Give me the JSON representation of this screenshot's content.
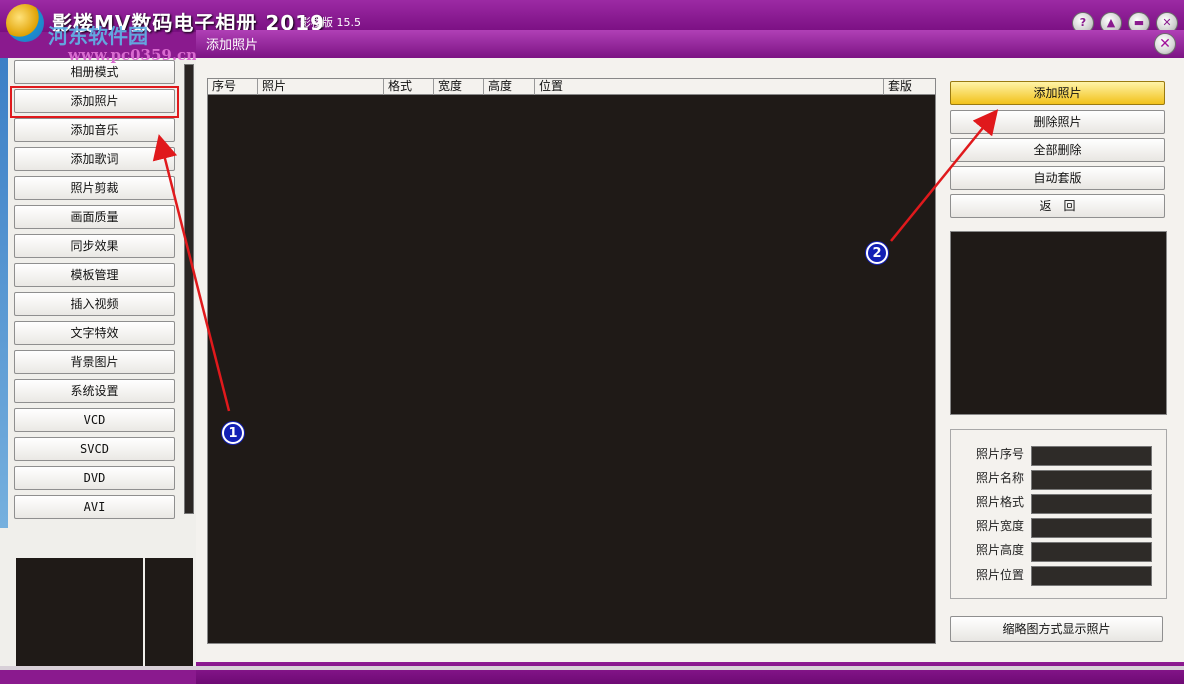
{
  "app": {
    "title": "影楼MV数码电子相册 2019",
    "edition": "影楼版 15.5",
    "watermark_brand": "河东软件园",
    "watermark_url": "www.pc0359.cn"
  },
  "dialog": {
    "title": "添加照片",
    "close_symbol": "✕"
  },
  "sidebar": {
    "items": [
      {
        "label": "相册模式"
      },
      {
        "label": "添加照片"
      },
      {
        "label": "添加音乐"
      },
      {
        "label": "添加歌词"
      },
      {
        "label": "照片剪裁"
      },
      {
        "label": "画面质量"
      },
      {
        "label": "同步效果"
      },
      {
        "label": "模板管理"
      },
      {
        "label": "插入视频"
      },
      {
        "label": "文字特效"
      },
      {
        "label": "背景图片"
      },
      {
        "label": "系统设置"
      },
      {
        "label": "VCD"
      },
      {
        "label": "SVCD"
      },
      {
        "label": "DVD"
      },
      {
        "label": "AVI"
      }
    ]
  },
  "table": {
    "columns": [
      "序号",
      "照片",
      "格式",
      "宽度",
      "高度",
      "位置",
      "套版"
    ]
  },
  "actions": {
    "add_photo": "添加照片",
    "delete_photo": "删除照片",
    "delete_all": "全部删除",
    "auto_template": "自动套版",
    "back": "返　回",
    "thumbnail_view": "缩略图方式显示照片"
  },
  "info": {
    "labels": [
      "照片序号",
      "照片名称",
      "照片格式",
      "照片宽度",
      "照片高度",
      "照片位置"
    ]
  },
  "annotations": {
    "marker1": "1",
    "marker2": "2"
  },
  "colors": {
    "accent_purple": "#8a1a8e",
    "highlight_red": "#e0191c",
    "marker_blue": "#1320b4",
    "active_button": "#f2c21a"
  }
}
